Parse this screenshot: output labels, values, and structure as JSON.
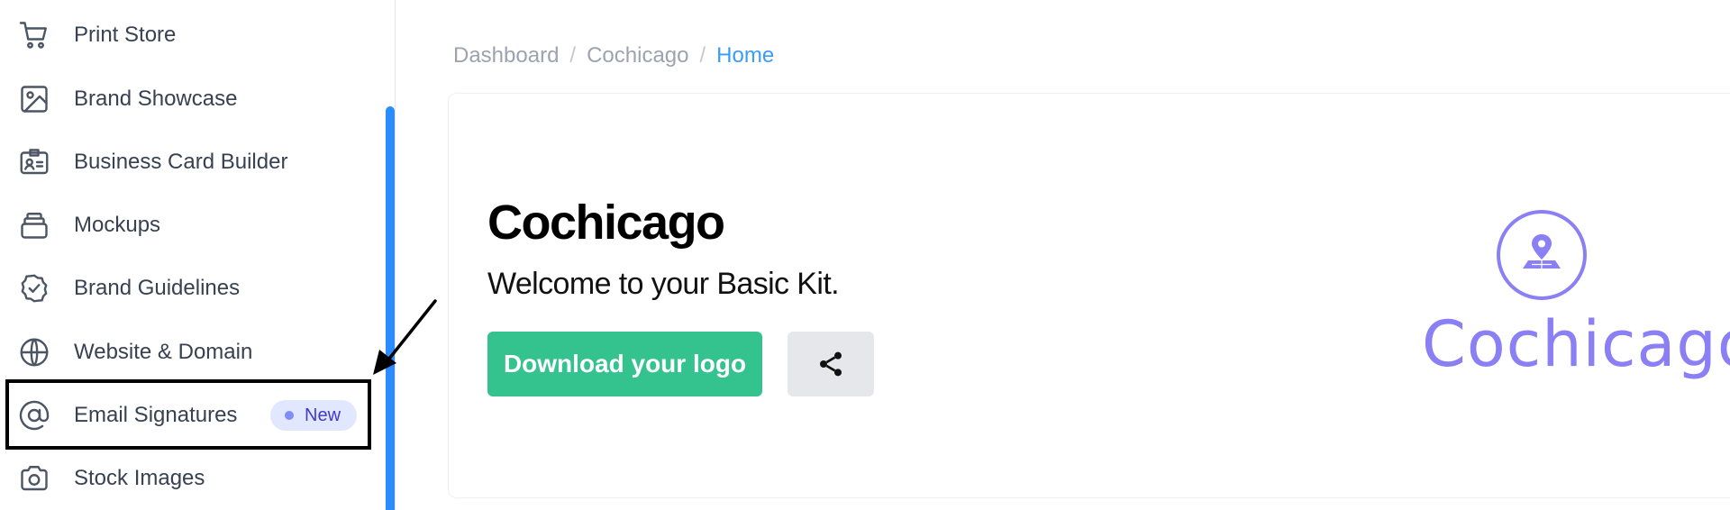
{
  "sidebar": {
    "items": [
      {
        "label": "Print Store",
        "icon": "cart-icon"
      },
      {
        "label": "Brand Showcase",
        "icon": "image-icon"
      },
      {
        "label": "Business Card Builder",
        "icon": "id-card-icon"
      },
      {
        "label": "Mockups",
        "icon": "stack-icon"
      },
      {
        "label": "Brand Guidelines",
        "icon": "badge-check-icon"
      },
      {
        "label": "Website & Domain",
        "icon": "globe-icon"
      },
      {
        "label": "Email Signatures",
        "icon": "at-sign-icon",
        "badge": "New"
      },
      {
        "label": "Stock Images",
        "icon": "camera-icon"
      }
    ]
  },
  "breadcrumb": {
    "items": [
      "Dashboard",
      "Cochicago",
      "Home"
    ],
    "separator": "/"
  },
  "hero": {
    "title": "Cochicago",
    "subtitle": "Welcome to your Basic Kit.",
    "download_label": "Download your logo",
    "share_icon": "share-icon"
  },
  "logo": {
    "text": "Cochicago",
    "icon": "map-pin-icon"
  },
  "colors": {
    "accent_blue": "#2a8cff",
    "download_green": "#34c38f",
    "logo_purple": "#8b7ff5",
    "badge_bg": "#e0e7ff"
  }
}
